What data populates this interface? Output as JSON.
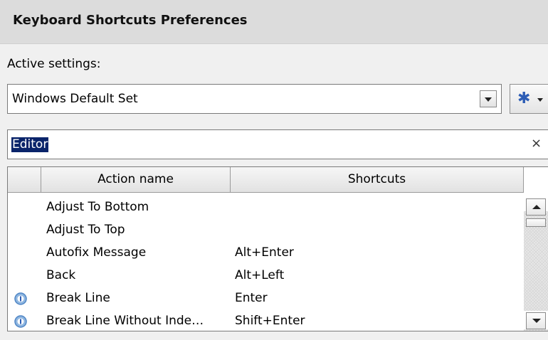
{
  "header": {
    "title": "Keyboard Shortcuts Preferences"
  },
  "active_settings": {
    "label": "Active settings:",
    "selected": "Windows Default Set"
  },
  "settings_menu": {
    "icon": "gear-icon"
  },
  "filter": {
    "value": "Editor",
    "clear_label": "×"
  },
  "table": {
    "columns": [
      "",
      "Action name",
      "Shortcuts"
    ],
    "rows": [
      {
        "icon": "",
        "action": "Adjust To Bottom",
        "shortcut": ""
      },
      {
        "icon": "",
        "action": "Adjust To Top",
        "shortcut": ""
      },
      {
        "icon": "",
        "action": "Autofix Message",
        "shortcut": "Alt+Enter"
      },
      {
        "icon": "",
        "action": "Back",
        "shortcut": "Alt+Left"
      },
      {
        "icon": "info-badge-icon",
        "action": "Break Line",
        "shortcut": "Enter"
      },
      {
        "icon": "info-badge-icon",
        "action": "Break Line Without Inde…",
        "shortcut": "Shift+Enter"
      }
    ]
  },
  "colors": {
    "header_bg": "#dcdcdc",
    "selection_bg": "#0a246a",
    "gear_blue": "#2d5db5",
    "info_icon_blue": "#4f86c6"
  }
}
